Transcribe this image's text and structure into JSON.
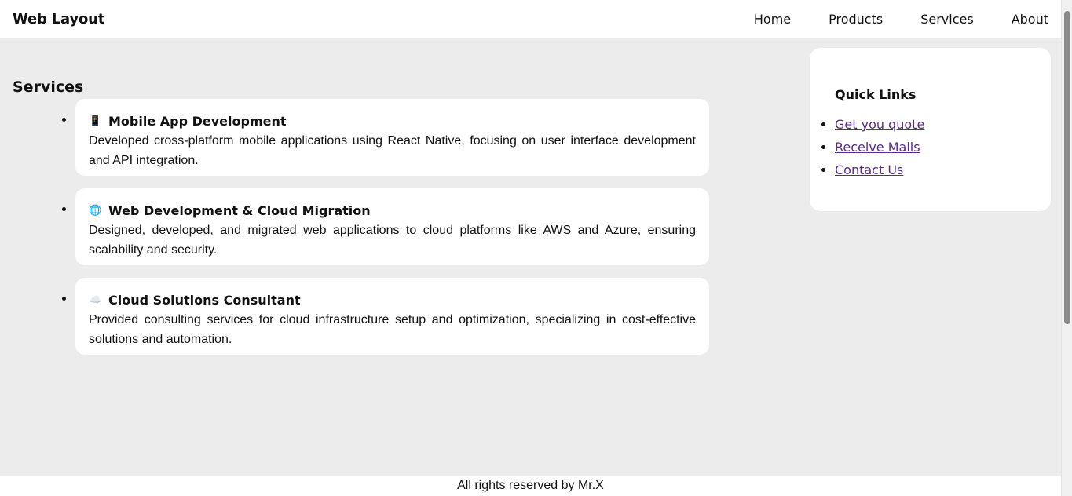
{
  "header": {
    "brand": "Web Layout",
    "nav": [
      "Home",
      "Products",
      "Services",
      "About"
    ]
  },
  "main": {
    "section_title": "Services",
    "services": [
      {
        "icon": "mobile-phone-icon",
        "glyph": "📱",
        "title": "Mobile App Development",
        "description": "Developed cross-platform mobile applications using React Native, focusing on user interface development and API integration."
      },
      {
        "icon": "globe-icon",
        "glyph": "🌐",
        "title": "Web Development & Cloud Migration",
        "description": "Designed, developed, and migrated web applications to cloud platforms like AWS and Azure, ensuring scalability and security."
      },
      {
        "icon": "cloud-icon",
        "glyph": "☁️",
        "title": "Cloud Solutions Consultant",
        "description": "Provided consulting services for cloud infrastructure setup and optimization, specializing in cost-effective solutions and automation."
      }
    ]
  },
  "aside": {
    "title": "Quick Links",
    "links": [
      "Get you quote",
      "Receive Mails",
      "Contact Us"
    ]
  },
  "footer": {
    "text": "All rights reserved by Mr.X"
  },
  "colors": {
    "background": "#ececec",
    "card": "#ffffff",
    "link": "#5b2a86"
  }
}
